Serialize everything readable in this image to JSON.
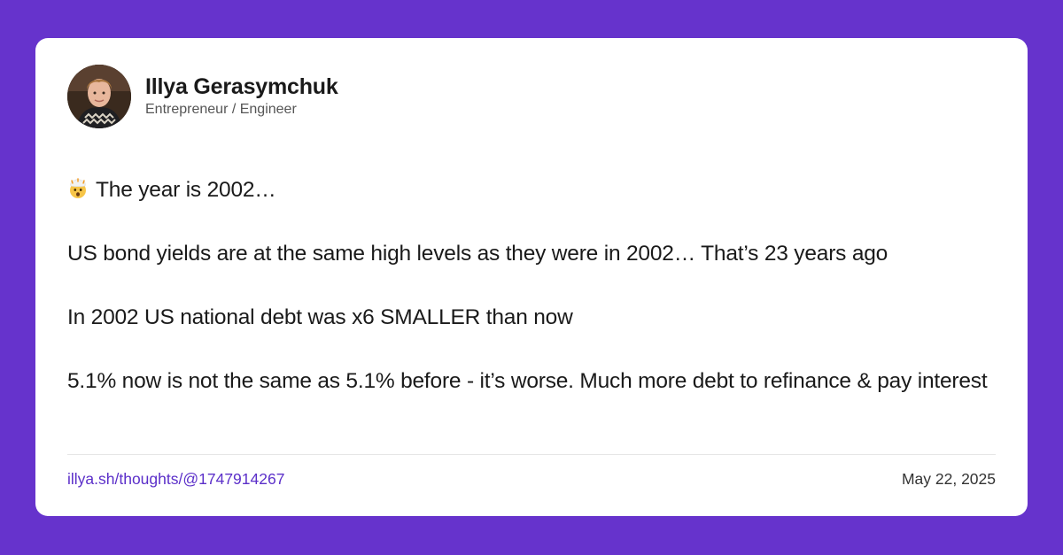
{
  "author": {
    "name": "Illya Gerasymchuk",
    "role": "Entrepreneur / Engineer"
  },
  "post": {
    "emoji_icon": "exploding-head-icon",
    "lines": [
      "The year is 2002…",
      "US bond yields are at the same high levels as they were in 2002… That’s 23 years ago",
      "In 2002 US national debt was x6 SMALLER than now",
      "5.1% now is not the same as 5.1% before - it’s worse. Much more debt to refinance & pay interest"
    ]
  },
  "footer": {
    "link": "illya.sh/thoughts/@1747914267",
    "date": "May 22, 2025"
  },
  "colors": {
    "background": "#6633cc",
    "card": "#ffffff",
    "link": "#5b2fc9"
  }
}
